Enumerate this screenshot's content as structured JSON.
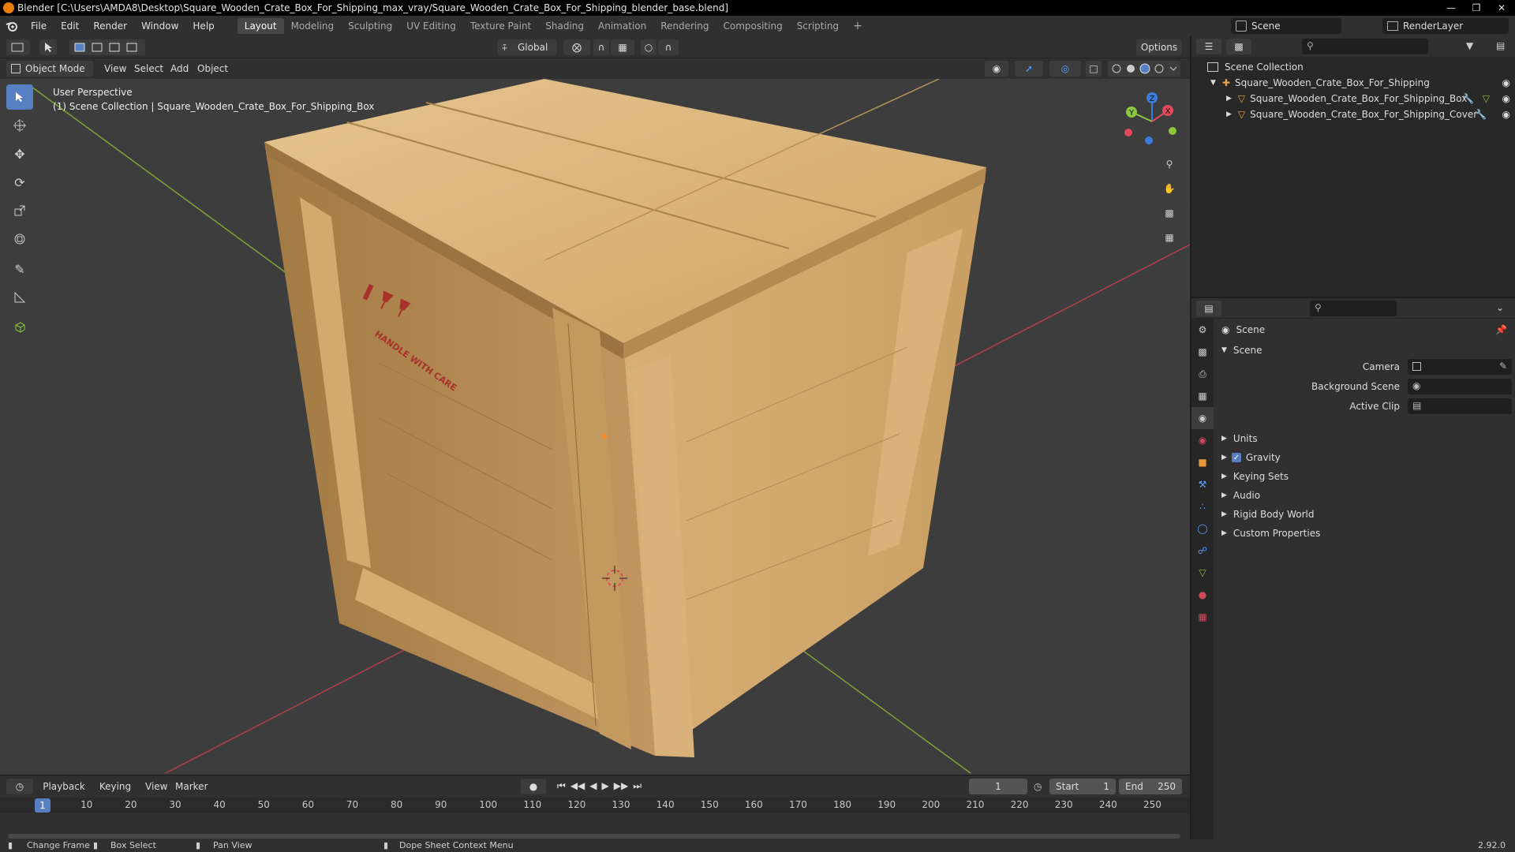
{
  "titlebar": {
    "title": "Blender [C:\\Users\\AMDA8\\Desktop\\Square_Wooden_Crate_Box_For_Shipping_max_vray/Square_Wooden_Crate_Box_For_Shipping_blender_base.blend]"
  },
  "menubar": {
    "items": [
      "File",
      "Edit",
      "Render",
      "Window",
      "Help"
    ]
  },
  "workspaces": [
    {
      "label": "Layout",
      "active": true
    },
    {
      "label": "Modeling"
    },
    {
      "label": "Sculpting"
    },
    {
      "label": "UV Editing"
    },
    {
      "label": "Texture Paint"
    },
    {
      "label": "Shading"
    },
    {
      "label": "Animation"
    },
    {
      "label": "Rendering"
    },
    {
      "label": "Compositing"
    },
    {
      "label": "Scripting"
    }
  ],
  "scene_selector": {
    "scene": "Scene",
    "view_layer": "RenderLayer"
  },
  "tool_header": {
    "orientation": "Global",
    "options": "Options"
  },
  "viewport_header": {
    "mode": "Object Mode",
    "menus": [
      "View",
      "Select",
      "Add",
      "Object"
    ]
  },
  "viewport": {
    "overlay_line1": "User Perspective",
    "overlay_line2": "(1) Scene Collection | Square_Wooden_Crate_Box_For_Shipping_Box",
    "crate_label": "HANDLE WITH CARE",
    "gizmo": {
      "x": "X",
      "y": "Y",
      "z": "Z"
    }
  },
  "timeline": {
    "menus": [
      "Playback",
      "Keying",
      "View",
      "Marker"
    ],
    "current_frame": "1",
    "start_label": "Start",
    "start": "1",
    "end_label": "End",
    "end": "250",
    "ticks": [
      "10",
      "20",
      "30",
      "40",
      "50",
      "60",
      "70",
      "80",
      "90",
      "100",
      "110",
      "120",
      "130",
      "140",
      "150",
      "160",
      "170",
      "180",
      "190",
      "200",
      "210",
      "220",
      "230",
      "240",
      "250"
    ],
    "playhead": "1"
  },
  "statusbar": {
    "change_frame": "Change Frame",
    "box_select": "Box Select",
    "pan_view": "Pan View",
    "context_menu": "Dope Sheet Context Menu",
    "version": "2.92.0"
  },
  "outliner": {
    "root": "Scene Collection",
    "collection": "Square_Wooden_Crate_Box_For_Shipping",
    "objects": [
      "Square_Wooden_Crate_Box_For_Shipping_Box",
      "Square_Wooden_Crate_Box_For_Shipping_Cover"
    ]
  },
  "properties": {
    "context": "Scene",
    "panel": "Scene",
    "fields": {
      "camera": "Camera",
      "background_scene": "Background Scene",
      "active_clip": "Active Clip"
    },
    "sections": [
      "Units",
      "Gravity",
      "Keying Sets",
      "Audio",
      "Rigid Body World",
      "Custom Properties"
    ],
    "gravity_checked": true
  },
  "colors": {
    "accent": "#5680c2",
    "header": "#303030",
    "viewport": "#3d3d3d",
    "axis_x": "#e04a5a",
    "axis_y": "#8cc63f",
    "axis_z": "#3b7ddd"
  }
}
